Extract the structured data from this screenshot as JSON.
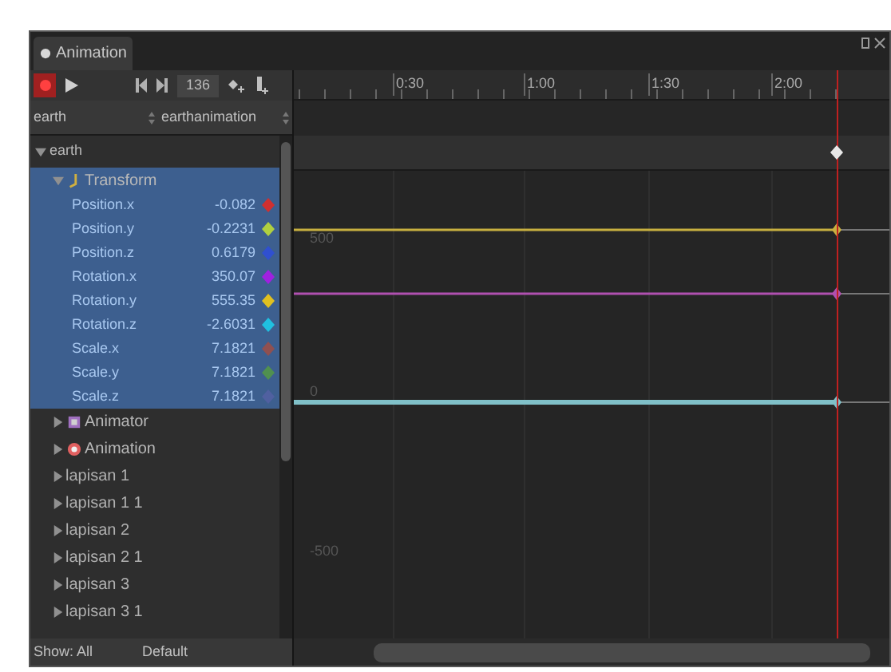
{
  "window": {
    "tab": "Animation"
  },
  "toolbar": {
    "recording": true,
    "frame": "136"
  },
  "timeline": {
    "ticks": [
      "0:30",
      "1:00",
      "1:30",
      "2:00"
    ]
  },
  "selectors": {
    "object": "earth",
    "clip": "earthanimation"
  },
  "hierarchy": [
    {
      "label": "earth",
      "expanded": true,
      "selected": false,
      "children": [
        {
          "label": "Transform",
          "kind": "component",
          "expanded": true,
          "selected": true,
          "children": [
            {
              "name": "Position.x",
              "value": "-0.082",
              "color": "#d03030",
              "selected": true
            },
            {
              "name": "Position.y",
              "value": "-0.2231",
              "color": "#b0d040",
              "selected": true
            },
            {
              "name": "Position.z",
              "value": "0.6179",
              "color": "#3050d0",
              "selected": true
            },
            {
              "name": "Rotation.x",
              "value": "350.07",
              "color": "#a020e0",
              "selected": true
            },
            {
              "name": "Rotation.y",
              "value": "555.35",
              "color": "#e0c020",
              "selected": true
            },
            {
              "name": "Rotation.z",
              "value": "-2.6031",
              "color": "#20c0e0",
              "selected": true
            },
            {
              "name": "Scale.x",
              "value": "7.1821",
              "color": "#905050",
              "selected": true
            },
            {
              "name": "Scale.y",
              "value": "7.1821",
              "color": "#509050",
              "selected": true
            },
            {
              "name": "Scale.z",
              "value": "7.1821",
              "color": "#5060a0",
              "selected": true
            }
          ]
        },
        {
          "label": "Animator",
          "kind": "component",
          "expanded": false,
          "selected": false
        },
        {
          "label": "Animation",
          "kind": "component",
          "expanded": false,
          "selected": false
        },
        {
          "label": "lapisan 1",
          "kind": "object",
          "expanded": false,
          "selected": false
        },
        {
          "label": "lapisan 1 1",
          "kind": "object",
          "expanded": false,
          "selected": false
        },
        {
          "label": "lapisan 2",
          "kind": "object",
          "expanded": false,
          "selected": false
        },
        {
          "label": "lapisan 2 1",
          "kind": "object",
          "expanded": false,
          "selected": false
        },
        {
          "label": "lapisan 3",
          "kind": "object",
          "expanded": false,
          "selected": false
        },
        {
          "label": "lapisan 3 1",
          "kind": "object",
          "expanded": false,
          "selected": false
        }
      ]
    }
  ],
  "curve_view": {
    "axis_labels": [
      "500",
      "0",
      "-500"
    ],
    "curves": [
      {
        "color": "#c8b040"
      },
      {
        "color": "#b050b0"
      },
      {
        "color": "#80c0c8"
      }
    ]
  },
  "footer": {
    "show": "Show: All",
    "mode": "Default"
  }
}
